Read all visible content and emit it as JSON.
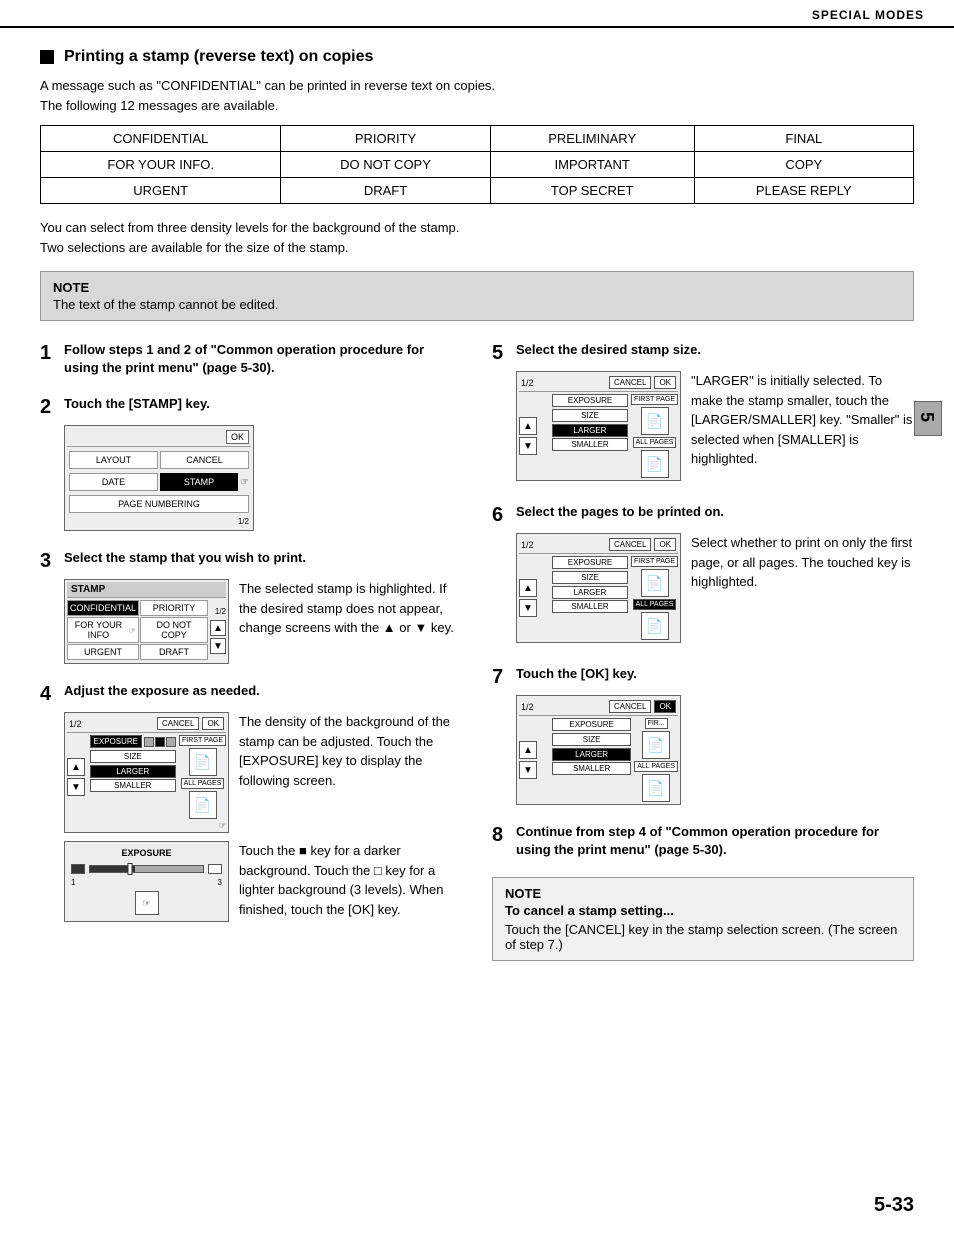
{
  "header": {
    "title": "SPECIAL MODES"
  },
  "section": {
    "heading": "Printing a stamp (reverse text) on copies",
    "intro_line1": "A message such as \"CONFIDENTIAL\" can be printed in reverse text on copies.",
    "intro_line2": "The following 12 messages are available."
  },
  "messages_table": {
    "rows": [
      [
        "CONFIDENTIAL",
        "PRIORITY",
        "PRELIMINARY",
        "FINAL"
      ],
      [
        "FOR YOUR INFO.",
        "DO NOT COPY",
        "IMPORTANT",
        "COPY"
      ],
      [
        "URGENT",
        "DRAFT",
        "TOP SECRET",
        "PLEASE REPLY"
      ]
    ]
  },
  "density_text": {
    "line1": "You can select from three density levels for the background of the stamp.",
    "line2": "Two selections are available for the size of the stamp."
  },
  "note_top": {
    "title": "NOTE",
    "text": "The text of the stamp cannot be edited."
  },
  "steps": {
    "step1": {
      "number": "1",
      "title": "Follow steps 1 and 2 of \"Common operation procedure for using the print menu\" (page 5-30)."
    },
    "step2": {
      "number": "2",
      "title": "Touch the [STAMP] key.",
      "ui_labels": {
        "layout": "LAYOUT",
        "cancel": "CANCEL",
        "ok": "OK",
        "date": "DATE",
        "stamp": "STAMP",
        "page_numbering": "PAGE NUMBERING",
        "counter": "1/2"
      }
    },
    "step3": {
      "number": "3",
      "title": "Select the stamp that you wish to print.",
      "body": "The selected stamp is highlighted. If the desired stamp does not appear, change screens with the ▲ or ▼ key.",
      "ui": {
        "header": "STAMP",
        "cells": [
          "CONFIDENTIAL",
          "PRIORITY",
          "FOR YOUR INFO",
          "DO NOT COPY",
          "URGENT",
          "DRAFT"
        ],
        "counter": "1/2"
      }
    },
    "step4": {
      "number": "4",
      "title": "Adjust the exposure as needed.",
      "body1": "The density of the background of the stamp can be adjusted. Touch the [EXPOSURE] key to display the following screen.",
      "body2_title": "",
      "exposure_ui": {
        "title": "EXPOSURE",
        "label1": "1",
        "label2": "3"
      },
      "body3": "Touch the ■ key for a darker background. Touch the □ key for a lighter background (3 levels). When finished, touch the [OK] key."
    },
    "step5": {
      "number": "5",
      "title": "Select the desired stamp size.",
      "body": "\"LARGER\" is initially selected. To make the stamp smaller, touch the [LARGER/SMALLER] key. \"Smaller\" is selected when [SMALLER] is highlighted.",
      "ui": {
        "cancel": "CANCEL",
        "ok": "OK",
        "counter": "1/2",
        "exposure": "EXPOSURE",
        "size": "SIZE",
        "larger": "LARGER",
        "smaller": "SMALLER",
        "first_page": "FIRST PAGE",
        "all_pages": "ALL PAGES"
      }
    },
    "step6": {
      "number": "6",
      "title": "Select the pages to be printed on.",
      "body": "Select whether to print on only the first page, or all pages. The touched key is highlighted.",
      "ui": {
        "cancel": "CANCEL",
        "ok": "OK",
        "counter": "1/2",
        "exposure": "EXPOSURE",
        "size": "SIZE",
        "larger": "LARGER",
        "smaller": "SMALLER",
        "first_page": "FIRST PAGE",
        "all_pages": "ALL PAGES"
      }
    },
    "step7": {
      "number": "7",
      "title": "Touch the [OK] key.",
      "ui": {
        "cancel": "CANCEL",
        "ok": "OK",
        "counter": "1/2",
        "exposure": "EXPOSURE",
        "size": "SIZE",
        "larger": "LARGER",
        "smaller": "SMALLER",
        "first_page": "FIRST PAGE",
        "all_pages": "ALL PAGES"
      }
    },
    "step8": {
      "number": "8",
      "title": "Continue from step 4 of \"Common operation procedure for using the print menu\" (page 5-30)."
    }
  },
  "note_bottom": {
    "title": "NOTE",
    "subtitle": "To cancel a stamp setting...",
    "text": "Touch the [CANCEL] key in the stamp selection screen. (The screen of step 7.)"
  },
  "side_tab": {
    "number": "5"
  },
  "page_number": "5-33"
}
